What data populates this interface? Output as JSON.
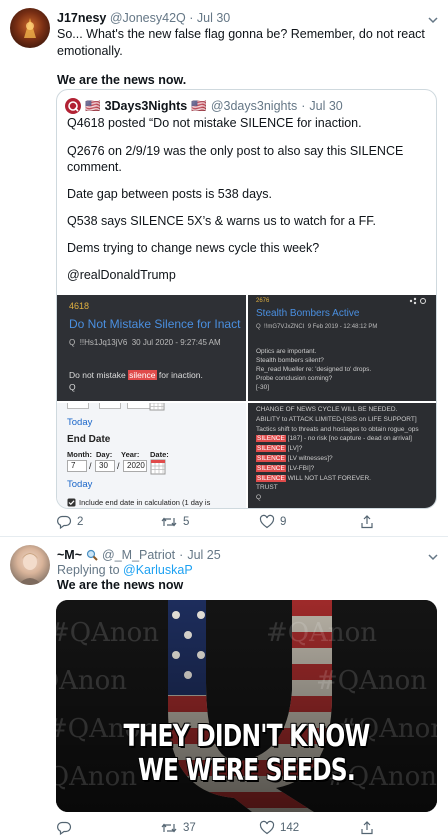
{
  "tweet1": {
    "name": "J17nesy",
    "handle": "@Jonesy42Q",
    "sep": "·",
    "time": "Jul 30",
    "line1": "So... What's the new false flag gonna be? Remember, do not react",
    "line2": "emotionally.",
    "line3": "We are the news now.",
    "quote": {
      "name": "3Days3Nights",
      "flag_left": "🇺🇸",
      "flag_right": "🇺🇸",
      "handle": "@3days3nights",
      "time": "Jul 30",
      "lines": [
        "Q4618 posted “Do not mistake SILENCE for inaction.",
        "",
        "Q2676 on 2/9/19 was the only post to also say this SILENCE",
        "comment.",
        "",
        "Date gap between posts is 538 days.",
        "",
        "Q538 says SILENCE 5X’s & warns us to watch for a FF.",
        "",
        "Dems trying to change news cycle this week?",
        "",
        "@realDonaldTrump"
      ],
      "img_left_top": {
        "num": "4618",
        "title": "Do Not Mistake Silence for Inact",
        "meta_q": "Q",
        "meta_id": "!!Hs1Jq13jV6",
        "meta_date": "30 Jul 2020 - 9:27:45 AM",
        "text_pre": "Do not mistake ",
        "text_hl": "silence",
        "text_post": " for inaction.",
        "sign": "Q"
      },
      "img_left_bottom": {
        "today1": "Today",
        "end_date": "End Date",
        "month_lbl": "Month:",
        "day_lbl": "Day:",
        "year_lbl": "Year:",
        "date_lbl": "Date:",
        "month": "7",
        "day": "30",
        "year": "2020",
        "slash": "/",
        "today2": "Today",
        "include": "Include end date in calculation (1 day is"
      },
      "img_right_top": {
        "num": "2676",
        "title": "Stealth Bombers Active",
        "meta_q": "Q",
        "meta_id": "!!mG7VJxZNCI",
        "meta_date": "9 Feb 2019 - 12:48:12 PM",
        "lines": [
          "Optics are important.",
          "Stealth bombers silent?",
          "Re_read Mueller re: 'designed to' drops.",
          "Probe conclusion coming?",
          "[-30]"
        ]
      },
      "img_right_bottom": {
        "lines": [
          "CHANGE OF NEWS CYCLE WILL BE NEEDED.",
          "ABILITY to ATTACK LIMITED-[ISIS on LIFE SUPPORT]",
          "Tactics shift to threats and hostages to obtain rogue_ops"
        ],
        "silence_rows": [
          {
            "tag": "SILENCE",
            "rest": " [187] - no risk [no capture - dead on arrival]"
          },
          {
            "tag": "SILENCE",
            "rest": " [LV]?"
          },
          {
            "tag": "SILENCE",
            "rest": " [LV witnesses]?"
          },
          {
            "tag": "SILENCE",
            "rest": " [LV-FBI]?"
          },
          {
            "tag": "SILENCE",
            "rest": " WILL NOT LAST FOREVER."
          }
        ],
        "trust": "TRUST",
        "sign": "Q"
      }
    },
    "actions": {
      "replies": "2",
      "retweets": "5",
      "likes": "9"
    }
  },
  "tweet2": {
    "name": "~M~",
    "handle": "@_M_Patriot",
    "sep": "·",
    "time": "Jul 25",
    "replying_prefix": "Replying to ",
    "replying_to": "@KarluskaP",
    "text": "We are the news now",
    "image": {
      "watermark": "#QAnon",
      "caption_line1": "THEY DIDN'T KNOW",
      "caption_line2": "WE WERE SEEDS."
    },
    "actions": {
      "replies": "",
      "retweets": "37",
      "likes": "142"
    }
  },
  "colors": {
    "link": "#1da1f2",
    "muted": "#657786",
    "silence_red": "#e04b4b",
    "panel_dark": "#2b2d31",
    "panel_blue": "#4a8fe0"
  }
}
